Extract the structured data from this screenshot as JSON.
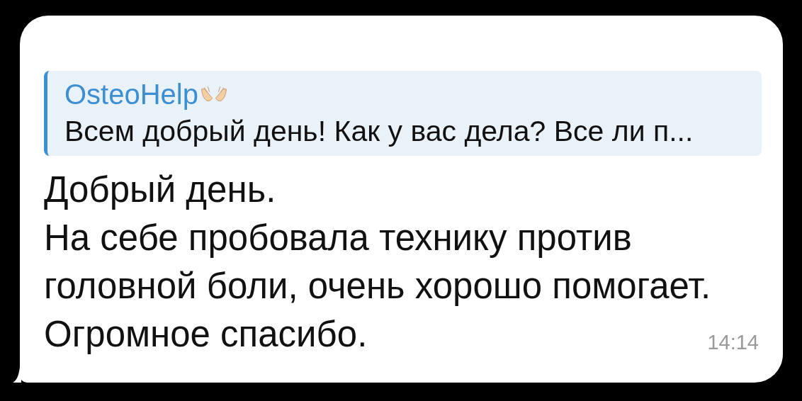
{
  "reply": {
    "author": "OsteoHelp",
    "text": "Всем добрый день! Как у вас дела? Все ли п..."
  },
  "message": {
    "lines": [
      "Добрый день.",
      "На себе пробовала технику против",
      "головной боли, очень хорошо помогает.",
      "Огромное спасибо."
    ],
    "time": "14:14"
  }
}
